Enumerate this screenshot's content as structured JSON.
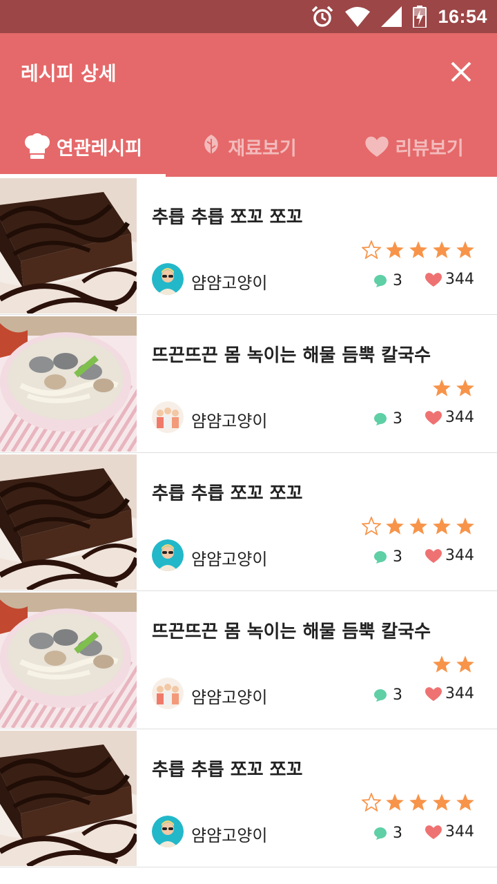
{
  "status_bar": {
    "time": "16:54",
    "icons": [
      "alarm-icon",
      "wifi-icon",
      "signal-icon",
      "battery-charging-icon"
    ]
  },
  "header": {
    "title": "레시피 상세",
    "close_icon": "close-icon"
  },
  "tabs": [
    {
      "label": "연관레시피",
      "icon": "chef-hat-icon",
      "active": true
    },
    {
      "label": "재료보기",
      "icon": "leaf-icon",
      "active": false
    },
    {
      "label": "리뷰보기",
      "icon": "heart-icon",
      "active": false
    }
  ],
  "colors": {
    "status_bar": "#9c4647",
    "app_bar": "#e5696a",
    "star": "#f7944a",
    "comment": "#5fcfa6",
    "like": "#ef7272"
  },
  "recipes": [
    {
      "title": "추릅 추릅 쪼꼬 쪼꼬",
      "author": "얌얌고양이",
      "comments": "3",
      "likes": "344",
      "rating": "4 of 5",
      "image": "chocolate-cake",
      "avatar": "avatar-sunglasses"
    },
    {
      "title": "뜨끈뜨끈 몸 녹이는 해물  듬뿍 칼국수",
      "author": "얌얌고양이",
      "comments": "3",
      "likes": "344",
      "rating": "2 filled stars",
      "image": "clam-noodle-soup",
      "avatar": "avatar-family"
    },
    {
      "title": "추릅 추릅 쪼꼬 쪼꼬",
      "author": "얌얌고양이",
      "comments": "3",
      "likes": "344",
      "rating": "4 of 5",
      "image": "chocolate-cake",
      "avatar": "avatar-sunglasses"
    },
    {
      "title": "뜨끈뜨끈 몸 녹이는 해물  듬뿍 칼국수",
      "author": "얌얌고양이",
      "comments": "3",
      "likes": "344",
      "rating": "2 filled stars",
      "image": "clam-noodle-soup",
      "avatar": "avatar-family"
    },
    {
      "title": "추릅 추릅 쪼꼬 쪼꼬",
      "author": "얌얌고양이",
      "comments": "3",
      "likes": "344",
      "rating": "4 of 5",
      "image": "chocolate-cake",
      "avatar": "avatar-sunglasses"
    }
  ]
}
